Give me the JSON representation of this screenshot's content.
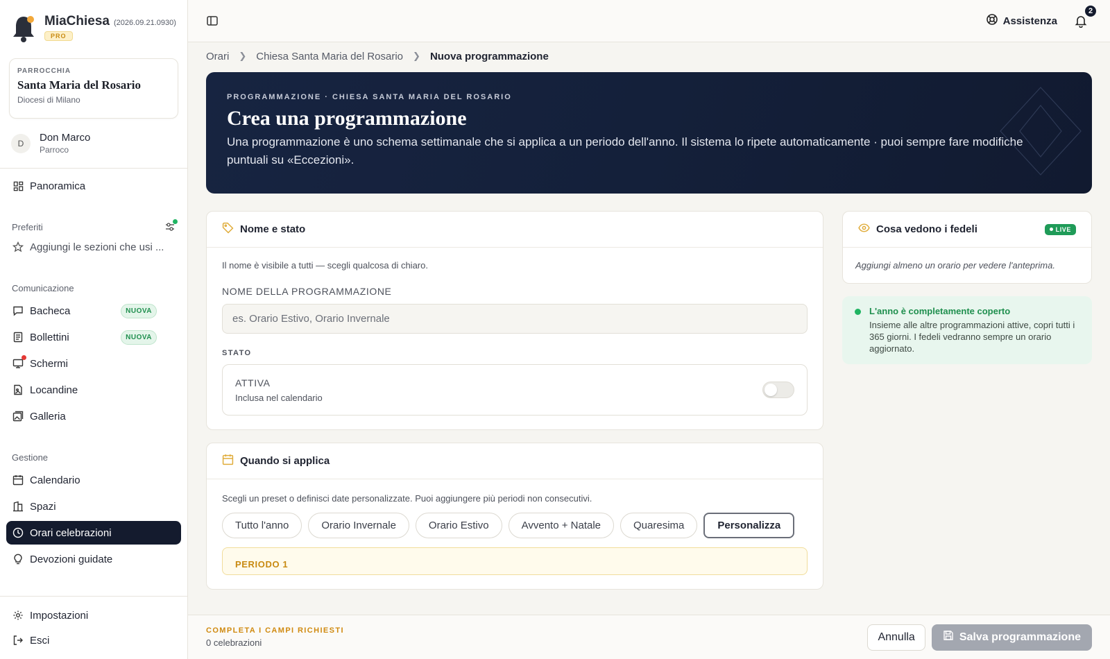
{
  "brand": {
    "name": "MiaChiesa",
    "version": "(2026.09.21.0930)",
    "plan": "PRO"
  },
  "parish": {
    "label": "PARROCCHIA",
    "name": "Santa Maria del Rosario",
    "diocese": "Diocesi di Milano"
  },
  "user": {
    "initial": "D",
    "name": "Don Marco",
    "role": "Parroco"
  },
  "nav": {
    "overview": "Panoramica",
    "favorites_title": "Preferiti",
    "favorites_add": "Aggiungi le sezioni che usi ...",
    "communication_title": "Comunicazione",
    "communication": [
      {
        "label": "Bacheca",
        "badge": "NUOVA"
      },
      {
        "label": "Bollettini",
        "badge": "NUOVA"
      },
      {
        "label": "Schermi"
      },
      {
        "label": "Locandine"
      },
      {
        "label": "Galleria"
      }
    ],
    "management_title": "Gestione",
    "management": [
      {
        "label": "Calendario"
      },
      {
        "label": "Spazi"
      },
      {
        "label": "Orari celebrazioni"
      },
      {
        "label": "Devozioni guidate"
      }
    ],
    "settings": "Impostazioni",
    "logout": "Esci"
  },
  "topbar": {
    "help": "Assistenza",
    "notifications": "2"
  },
  "breadcrumb": [
    "Orari",
    "Chiesa Santa Maria del Rosario",
    "Nuova programmazione"
  ],
  "hero": {
    "kicker": "PROGRAMMAZIONE · CHIESA SANTA MARIA DEL ROSARIO",
    "title": "Crea una programmazione",
    "description": "Una programmazione è uno schema settimanale che si applica a un periodo dell'anno. Il sistema lo ripete automaticamente · puoi sempre fare modifiche puntuali su «Eccezioni»."
  },
  "name_card": {
    "title": "Nome e stato",
    "hint": "Il nome è visibile a tutti — scegli qualcosa di chiaro.",
    "name_label": "NOME DELLA PROGRAMMAZIONE",
    "name_placeholder": "es. Orario Estivo, Orario Invernale",
    "name_value": "",
    "state_label": "STATO",
    "state_title": "ATTIVA",
    "state_sub": "Inclusa nel calendario"
  },
  "when_card": {
    "title": "Quando si applica",
    "hint": "Scegli un preset o definisci date personalizzate. Puoi aggiungere più periodi non consecutivi.",
    "presets": [
      "Tutto l'anno",
      "Orario Invernale",
      "Orario Estivo",
      "Avvento + Natale",
      "Quaresima",
      "Personalizza"
    ],
    "period_label": "PERIODO 1"
  },
  "preview": {
    "title": "Cosa vedono i fedeli",
    "badge": "LIVE",
    "empty": "Aggiungi almeno un orario per vedere l'anteprima."
  },
  "coverage": {
    "title": "L'anno è completamente coperto",
    "text": "Insieme alle altre programmazioni attive, copri tutti i 365 giorni. I fedeli vedranno sempre un orario aggiornato."
  },
  "footer": {
    "warning": "COMPLETA I CAMPI RICHIESTI",
    "count": "0 celebrazioni",
    "cancel": "Annulla",
    "save": "Salva programmazione"
  },
  "colors": {
    "navy": "#141b2e",
    "accent_gold": "#c88a12",
    "green": "#1f9b58",
    "red_dot": "#e53935"
  }
}
